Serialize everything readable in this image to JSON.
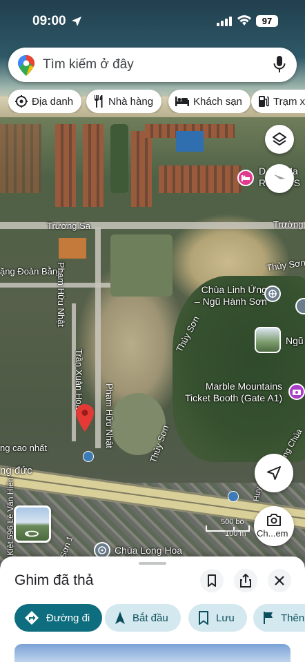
{
  "status_bar": {
    "time": "09:00",
    "battery": "97"
  },
  "search": {
    "placeholder": "Tìm kiếm ở đây"
  },
  "chips": [
    {
      "label": "Địa danh",
      "icon": "landmark-icon"
    },
    {
      "label": "Nhà hàng",
      "icon": "restaurant-icon"
    },
    {
      "label": "Khách sạn",
      "icon": "hotel-icon"
    },
    {
      "label": "Trạm xă",
      "icon": "gas-station-icon"
    }
  ],
  "map": {
    "labels": {
      "truong_sa_left": "Trường Sa",
      "truong_sa_right": "Trường",
      "dang_doan_bang": "ặng Đoàn Bằng",
      "pham_huu_nhat_1": "Phạm Hữu Nhật",
      "pham_huu_nhat_2": "Phạm Hữu Nhật",
      "tran_xuan_hoa": "Trần Xuân Hoà",
      "thuy_son_1": "Thủy Sơn",
      "thuy_son_2": "Thủy Sơn",
      "thuy_son_3": "Thủy Sơn",
      "hoang_cao_nhat": "ng cao nhất",
      "ng_duc": "ng đức",
      "le_van_hien": "Kiệt 596 Lê Văn Hiến",
      "son_1": "Sơn 1",
      "cong_chua": "Công Chúa",
      "huy": "Huy"
    },
    "pois": {
      "resort_line1": "D",
      "resort_line1b": "Ma",
      "resort_line2": "Re",
      "resort_line2b": "& S",
      "chua_linh_ung_1": "Chùa Linh Ứng",
      "chua_linh_ung_2": "– Ngũ Hành Sơn",
      "ngu": "Ngũ",
      "marble_1": "Marble Mountains",
      "marble_2": "Ticket Booth (Gate A1)",
      "chua_long_hoa": "Chùa Long Hoa"
    },
    "scale": {
      "feet": "500 bộ",
      "meters": "100 m"
    },
    "lens_label": "Ch...em"
  },
  "sheet": {
    "title": "Ghim đã thả",
    "actions": [
      {
        "label": "Đường đi",
        "icon": "directions-icon"
      },
      {
        "label": "Bắt đầu",
        "icon": "navigation-icon"
      },
      {
        "label": "Lưu",
        "icon": "bookmark-icon"
      },
      {
        "label": "Thên",
        "icon": "flag-icon"
      }
    ]
  },
  "colors": {
    "accent": "#0e6e7f",
    "pin_red": "#e53935",
    "hotel_pink": "#e13b8f",
    "action_bg": "#d3e8ef"
  }
}
